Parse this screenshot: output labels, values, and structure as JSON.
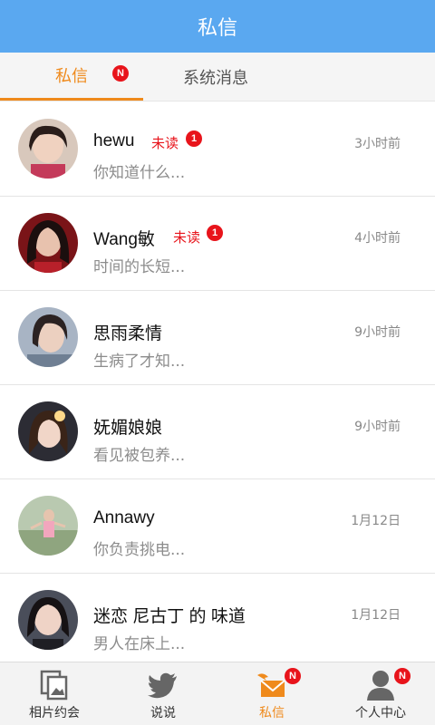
{
  "header": {
    "title": "私信"
  },
  "tabs": [
    {
      "label": "私信",
      "badge": "N"
    },
    {
      "label": "系统消息"
    }
  ],
  "colors": {
    "accent": "#ef8a1c",
    "header": "#5aa8f0",
    "badge": "#e8141b"
  },
  "messages": [
    {
      "name": "hewu",
      "unread_label": "未读",
      "unread_count": "1",
      "time": "3小时前",
      "preview": "你知道什么..."
    },
    {
      "name": "Wang敏",
      "unread_label": "未读",
      "unread_count": "1",
      "time": "4小时前",
      "preview": "时间的长短..."
    },
    {
      "name": "思雨柔情",
      "time": "9小时前",
      "preview": "生病了才知..."
    },
    {
      "name": "妩媚娘娘",
      "time": "9小时前",
      "preview": "看见被包养..."
    },
    {
      "name": "Annawy",
      "time": "1月12日",
      "preview": "你负责挑电..."
    },
    {
      "name": "迷恋 尼古丁 的 味道",
      "time": "1月12日",
      "preview": "男人在床上..."
    }
  ],
  "bottom_nav": [
    {
      "label": "相片约会",
      "icon": "photos-icon"
    },
    {
      "label": "说说",
      "icon": "bird-icon"
    },
    {
      "label": "私信",
      "icon": "mail-icon",
      "badge": "N"
    },
    {
      "label": "个人中心",
      "icon": "person-icon",
      "badge": "N"
    }
  ]
}
